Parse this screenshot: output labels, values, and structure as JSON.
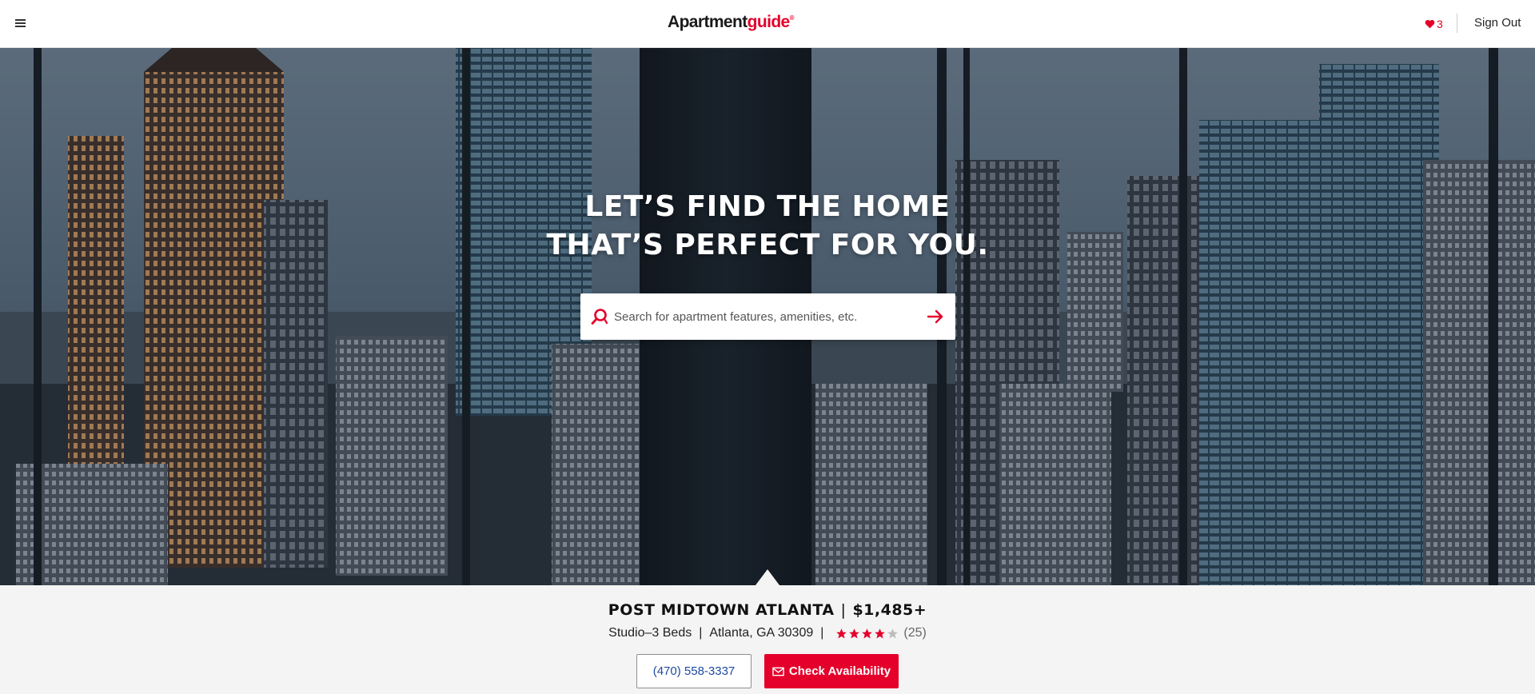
{
  "header": {
    "logo": {
      "part1": "Apartment",
      "part2": "guide",
      "reg": "®"
    },
    "favorites_count": "3",
    "sign_out_label": "Sign Out"
  },
  "hero": {
    "headline_line1": "LET’S FIND THE HOME",
    "headline_line2": "THAT’S PERFECT FOR YOU.",
    "search_placeholder": "Search for apartment features, amenities, etc."
  },
  "property": {
    "name": "POST MIDTOWN ATLANTA",
    "separator": "|",
    "price": "$1,485+",
    "beds": "Studio–3 Beds",
    "location": "Atlanta, GA 30309",
    "rating": 4,
    "rating_max": 5,
    "review_count": "(25)",
    "phone_label": "(470) 558-3337",
    "check_label": "Check Availability"
  },
  "icons": {
    "menu": "hamburger-menu-icon",
    "favorites": "heart-icon",
    "search": "search-icon",
    "submit": "arrow-right-icon",
    "rating": "star-icon",
    "mail": "envelope-icon"
  },
  "colors": {
    "brand_red": "#e4002b",
    "phone_text": "#1f4aa0",
    "strip_bg": "#f4f4f4"
  }
}
